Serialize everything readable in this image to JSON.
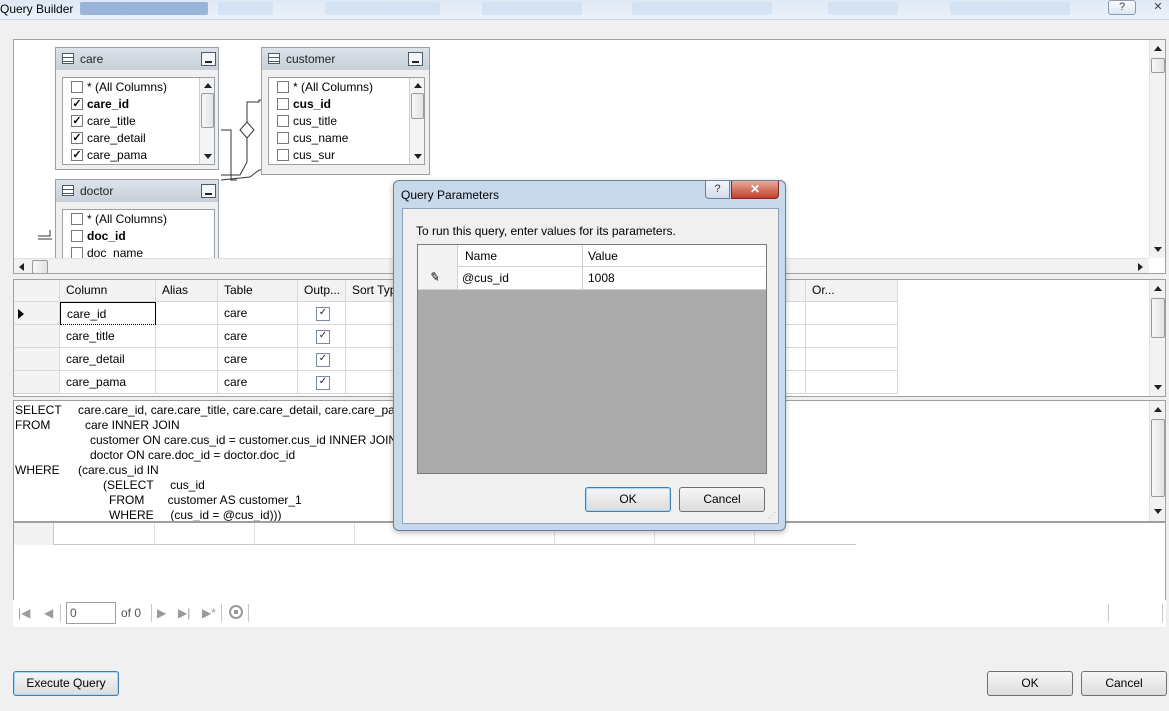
{
  "window": {
    "title": "Query Builder",
    "help_glyph": "?",
    "close_glyph": "✕"
  },
  "diagram": {
    "tables": [
      {
        "name": "care",
        "columns": [
          {
            "label": "* (All Columns)",
            "checked": false,
            "bold": false
          },
          {
            "label": "care_id",
            "checked": true,
            "bold": true
          },
          {
            "label": "care_title",
            "checked": true,
            "bold": false
          },
          {
            "label": "care_detail",
            "checked": true,
            "bold": false
          },
          {
            "label": "care_pama",
            "checked": true,
            "bold": false
          }
        ]
      },
      {
        "name": "customer",
        "columns": [
          {
            "label": "* (All Columns)",
            "checked": false,
            "bold": false
          },
          {
            "label": "cus_id",
            "checked": false,
            "bold": true
          },
          {
            "label": "cus_title",
            "checked": false,
            "bold": false
          },
          {
            "label": "cus_name",
            "checked": false,
            "bold": false
          },
          {
            "label": "cus_sur",
            "checked": false,
            "bold": false
          }
        ]
      },
      {
        "name": "doctor",
        "columns": [
          {
            "label": "* (All Columns)",
            "checked": false,
            "bold": false
          },
          {
            "label": "doc_id",
            "checked": false,
            "bold": true
          },
          {
            "label": "doc_name",
            "checked": false,
            "bold": false
          }
        ]
      }
    ]
  },
  "grid": {
    "headers": [
      "Column",
      "Alias",
      "Table",
      "Outp...",
      "Sort Typ",
      "Or..."
    ],
    "rows": [
      {
        "column": "care_id",
        "alias": "",
        "table": "care",
        "output": true
      },
      {
        "column": "care_title",
        "alias": "",
        "table": "care",
        "output": true
      },
      {
        "column": "care_detail",
        "alias": "",
        "table": "care",
        "output": true
      },
      {
        "column": "care_pama",
        "alias": "",
        "table": "care",
        "output": true
      }
    ]
  },
  "sql": {
    "lines": [
      {
        "kw": "SELECT",
        "text": "care.care_id, care.care_title, care.care_detail, care.care_pama"
      },
      {
        "kw": "FROM",
        "text": "care INNER JOIN"
      },
      {
        "kw": "",
        "text": "customer ON care.cus_id = customer.cus_id INNER JOIN"
      },
      {
        "kw": "",
        "text": "doctor ON care.doc_id = doctor.doc_id"
      },
      {
        "kw": "WHERE",
        "text": "(care.cus_id IN"
      },
      {
        "kw": "",
        "text": "(SELECT     cus_id"
      },
      {
        "kw": "",
        "text": "FROM       customer AS customer_1"
      },
      {
        "kw": "",
        "text": "WHERE     (cus_id = @cus_id)))"
      }
    ]
  },
  "navigator": {
    "position": "0",
    "of_label": "of 0"
  },
  "buttons": {
    "execute": "Execute Query",
    "ok": "OK",
    "cancel": "Cancel"
  },
  "dialog": {
    "title": "Query Parameters",
    "help_glyph": "?",
    "close_glyph": "✕",
    "instruction": "To run this query, enter values for its parameters.",
    "headers": {
      "name": "Name",
      "value": "Value"
    },
    "params": [
      {
        "name": "@cus_id",
        "value": "1008"
      }
    ],
    "ok": "OK",
    "cancel": "Cancel"
  }
}
